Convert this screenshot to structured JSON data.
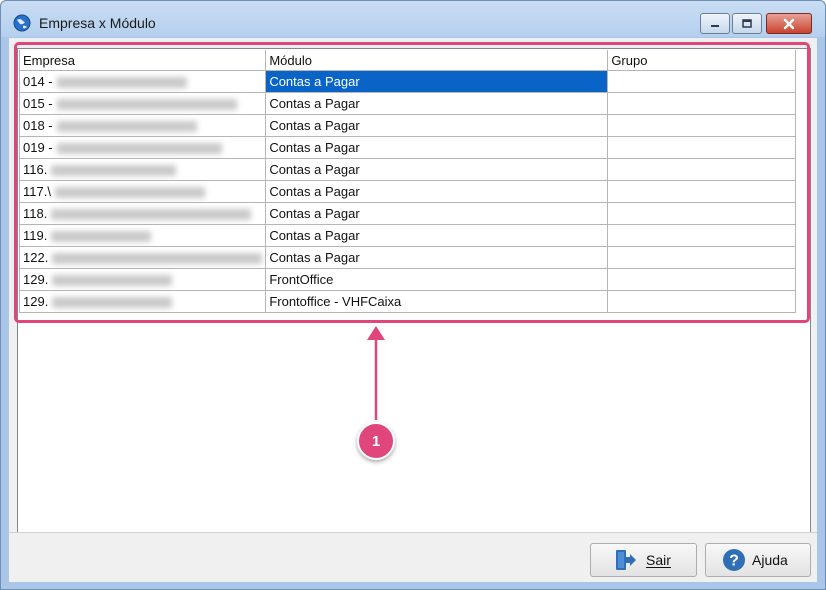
{
  "window": {
    "title": "Empresa x Módulo"
  },
  "grid": {
    "columns": [
      "Empresa",
      "Módulo",
      "Grupo"
    ],
    "rows": [
      {
        "empresa": "014 -",
        "modulo": "Contas a Pagar",
        "grupo": "",
        "selected": true
      },
      {
        "empresa": "015  -",
        "modulo": "Contas a Pagar",
        "grupo": ""
      },
      {
        "empresa": "018  -",
        "modulo": "Contas a Pagar",
        "grupo": ""
      },
      {
        "empresa": "019 -",
        "modulo": "Contas a Pagar",
        "grupo": ""
      },
      {
        "empresa": "116.",
        "modulo": "Contas a Pagar",
        "grupo": ""
      },
      {
        "empresa": "117.\\",
        "modulo": "Contas a Pagar",
        "grupo": ""
      },
      {
        "empresa": "118.",
        "modulo": "Contas a Pagar",
        "grupo": ""
      },
      {
        "empresa": "119.",
        "modulo": "Contas a Pagar",
        "grupo": ""
      },
      {
        "empresa": "122.",
        "modulo": "Contas a Pagar",
        "grupo": ""
      },
      {
        "empresa": "129.",
        "modulo": "FrontOffice",
        "grupo": ""
      },
      {
        "empresa": "129.",
        "modulo": "Frontoffice - VHFCaixa",
        "grupo": ""
      }
    ]
  },
  "callout": {
    "number": "1",
    "color": "#e0457b"
  },
  "buttons": {
    "sair": "Sair",
    "ajuda": "Ajuda"
  },
  "icons": {
    "title": "globe-icon",
    "sair": "exit-door-icon",
    "ajuda": "help-icon"
  }
}
